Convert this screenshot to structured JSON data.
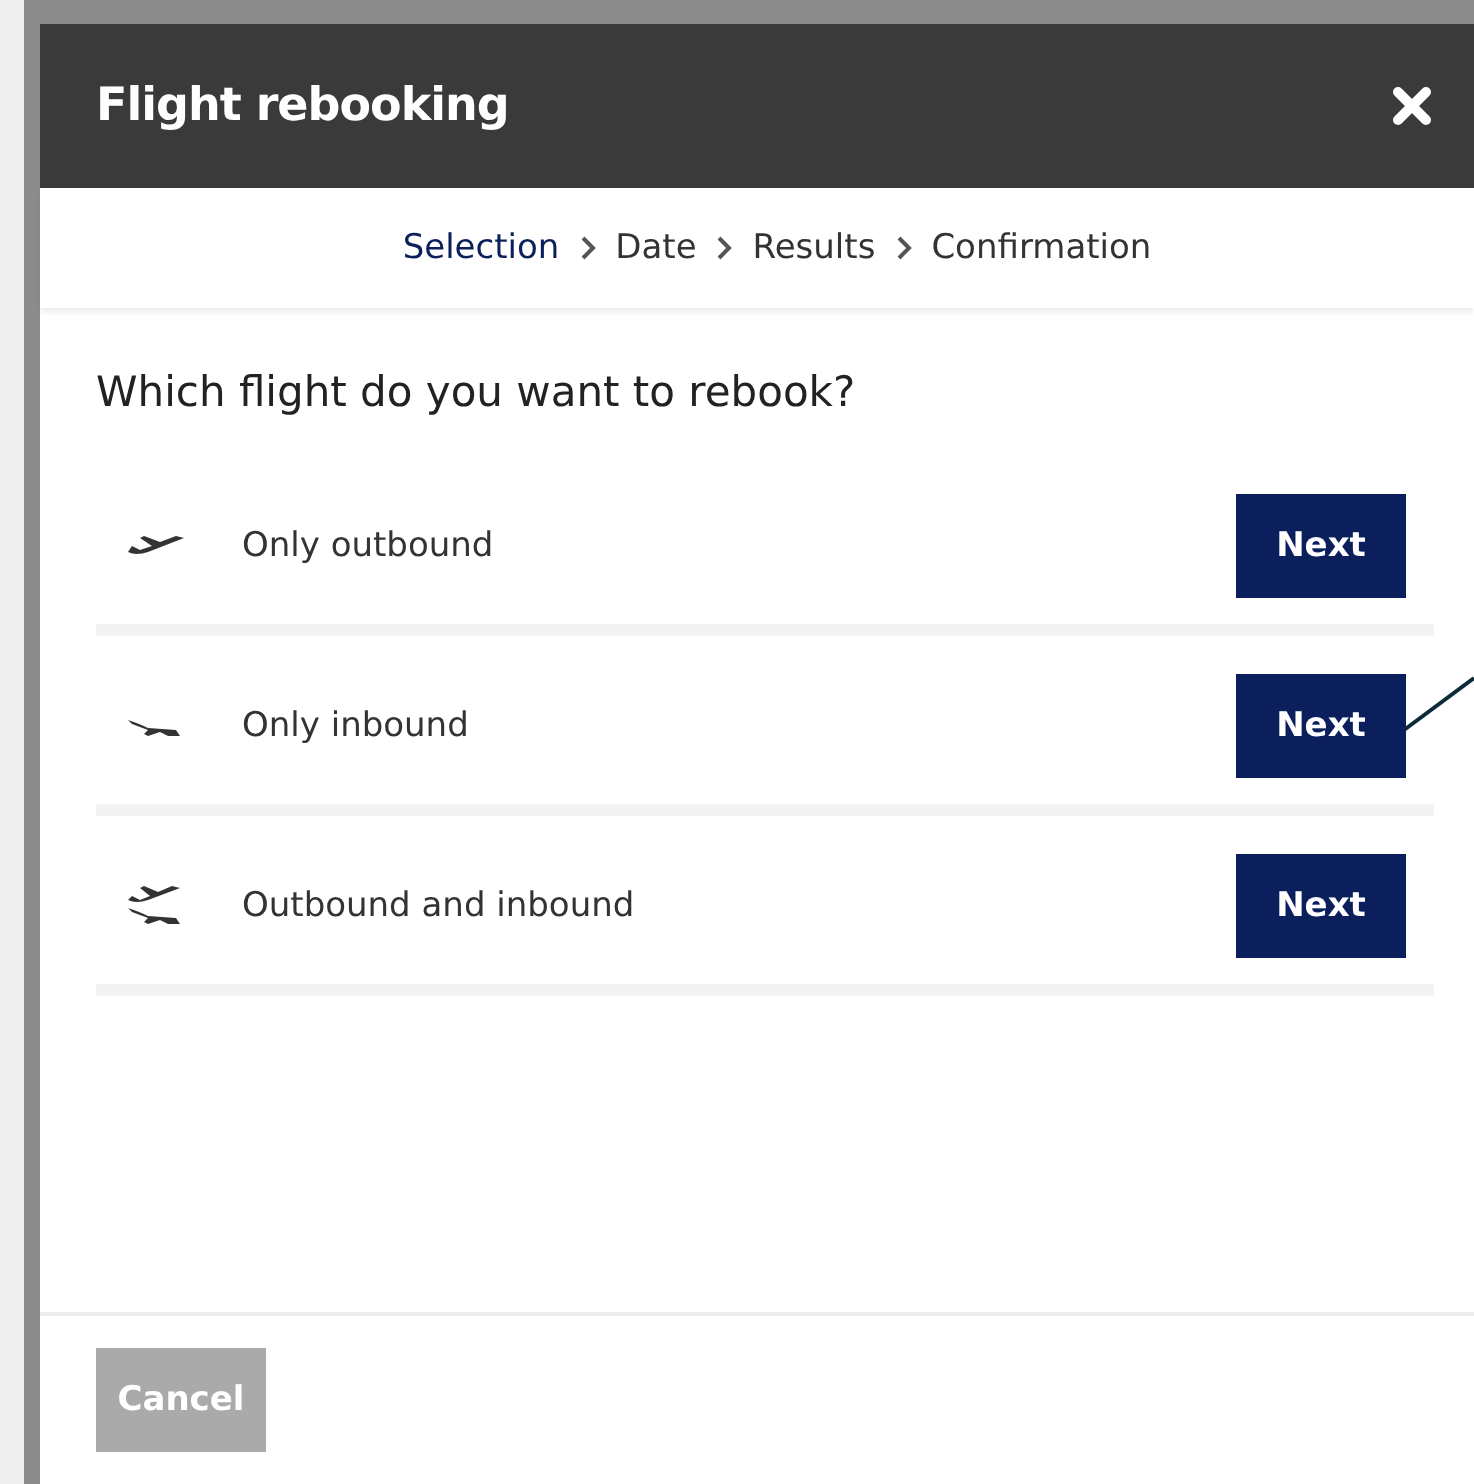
{
  "dialog": {
    "title": "Flight rebooking"
  },
  "steps": [
    {
      "label": "Selection",
      "selected": true
    },
    {
      "label": "Date",
      "selected": false
    },
    {
      "label": "Results",
      "selected": false
    },
    {
      "label": "Confirmation",
      "selected": false
    }
  ],
  "question": "Which flight do you want to rebook?",
  "options": [
    {
      "kind": "outbound",
      "label": "Only outbound",
      "button": "Next"
    },
    {
      "kind": "inbound",
      "label": "Only inbound",
      "button": "Next"
    },
    {
      "kind": "both",
      "label": "Outbound and inbound",
      "button": "Next"
    }
  ],
  "footer": {
    "cancel": {
      "label": "Cancel",
      "disabled": true
    }
  }
}
